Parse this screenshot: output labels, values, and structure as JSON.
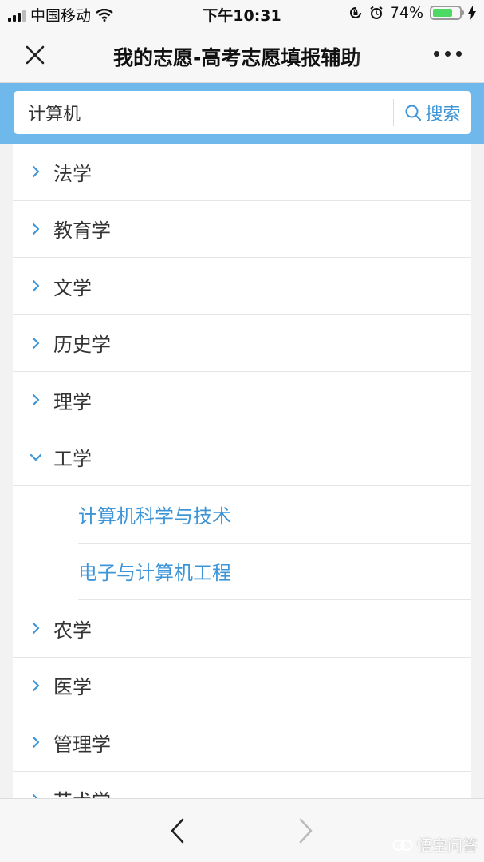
{
  "status_bar": {
    "carrier": "中国移动",
    "time": "下午10:31",
    "battery_percent": 74
  },
  "nav": {
    "title": "我的志愿-高考志愿填报辅助"
  },
  "search": {
    "value": "计算机",
    "button_label": "搜索"
  },
  "categories": [
    {
      "label": "法学",
      "expanded": false
    },
    {
      "label": "教育学",
      "expanded": false
    },
    {
      "label": "文学",
      "expanded": false
    },
    {
      "label": "历史学",
      "expanded": false
    },
    {
      "label": "理学",
      "expanded": false
    },
    {
      "label": "工学",
      "expanded": true,
      "children": [
        "计算机科学与技术",
        "电子与计算机工程"
      ]
    },
    {
      "label": "农学",
      "expanded": false
    },
    {
      "label": "医学",
      "expanded": false
    },
    {
      "label": "管理学",
      "expanded": false
    },
    {
      "label": "艺术学",
      "expanded": false
    }
  ],
  "watermark": {
    "text": "悟空问答"
  },
  "colors": {
    "accent": "#3d95d8",
    "search_band": "#6eb8ec",
    "battery": "#4cd964"
  }
}
